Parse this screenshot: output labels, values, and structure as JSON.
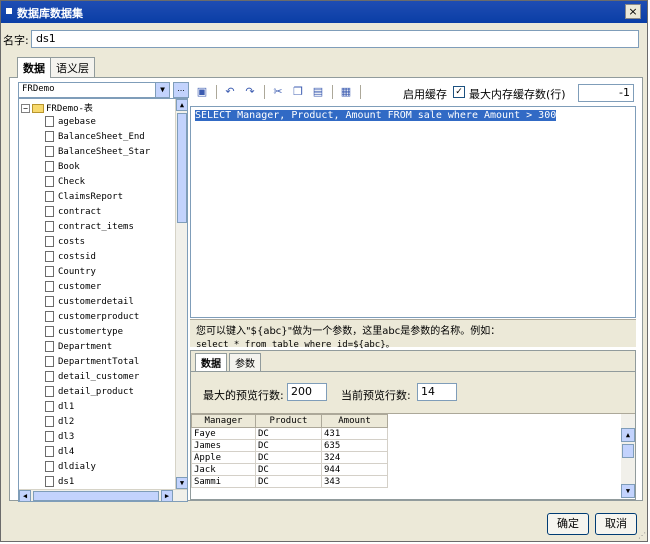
{
  "window": {
    "title": "数据库数据集",
    "close": "×"
  },
  "name": {
    "label": "名字:",
    "value": "ds1"
  },
  "tabs": [
    "数据",
    "语义层"
  ],
  "datasource": {
    "selected": "FRDemo",
    "more": "..."
  },
  "tree": {
    "root": "FRDemo-表",
    "items": [
      "agebase",
      "BalanceSheet_End",
      "BalanceSheet_Star",
      "Book",
      "Check",
      "ClaimsReport",
      "contract",
      "contract_items",
      "costs",
      "costsid",
      "Country",
      "customer",
      "customerdetail",
      "customerproduct",
      "customertype",
      "Department",
      "DepartmentTotal",
      "detail_customer",
      "detail_product",
      "dl1",
      "dl2",
      "dl3",
      "dl4",
      "dldialy",
      "ds1"
    ]
  },
  "toolbar": {
    "icons": [
      "preview-icon",
      "undo-icon",
      "redo-icon",
      "cut-icon",
      "copy-icon",
      "paste-icon",
      "format-icon"
    ],
    "cache_label": "启用缓存",
    "cache_checked": true,
    "maxrows_label": "最大内存缓存数(行)",
    "maxrows_value": "-1"
  },
  "sql": "SELECT Manager, Product, Amount FROM sale where Amount > 300",
  "hint": {
    "line1": "您可以键入\"${abc}\"做为一个参数，这里abc是参数的名称。例如：",
    "line2": "select * from table where id=${abc}。"
  },
  "preview": {
    "tabs": [
      "数据",
      "参数"
    ],
    "max_label": "最大的预览行数:",
    "max_value": "200",
    "current_label": "当前预览行数:",
    "current_value": "14",
    "columns": [
      "Manager",
      "Product",
      "Amount"
    ],
    "rows": [
      [
        "Faye",
        "DC",
        "431"
      ],
      [
        "James",
        "DC",
        "635"
      ],
      [
        "Apple",
        "DC",
        "324"
      ],
      [
        "Jack",
        "DC",
        "944"
      ],
      [
        "Sammi",
        "DC",
        "343"
      ]
    ]
  },
  "buttons": {
    "ok": "确定",
    "cancel": "取消"
  }
}
